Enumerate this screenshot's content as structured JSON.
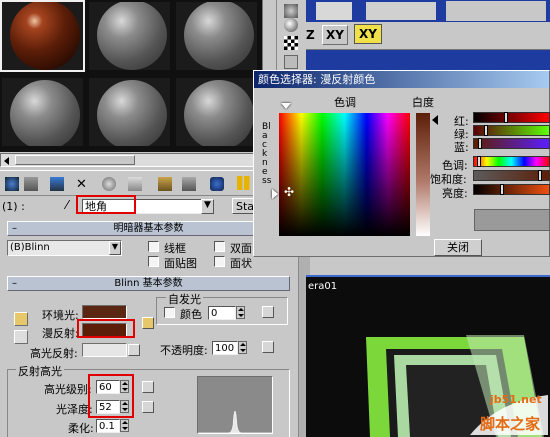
{
  "material_editor": {
    "shader_channel": "(1) :",
    "material_name": "地角",
    "standard_button": "Standard",
    "shader_rollout_title": "明暗器基本参数",
    "shader_type": "(B)Blinn",
    "options": {
      "wire": "线框",
      "two_sided": "双面",
      "face_map": "面贴图",
      "faceted": "面状"
    },
    "blinn_rollout_title": "Blinn 基本参数",
    "ambient_label": "环境光:",
    "diffuse_label": "漫反射:",
    "specular_label": "高光反射:",
    "self_illum_title": "自发光",
    "self_illum_color_label": "颜色",
    "self_illum_value": "0",
    "opacity_label": "不透明度:",
    "opacity_value": "100",
    "specular_group_title": "反射高光",
    "specular_level_label": "高光级别:",
    "specular_level_value": "60",
    "glossiness_label": "光泽度:",
    "glossiness_value": "52",
    "soften_label": "柔化:",
    "soften_value": "0.1",
    "colors": {
      "ambient": "#5a2812",
      "diffuse": "#5c1e08",
      "specular": "#e6e6e6"
    }
  },
  "color_picker": {
    "title": "颜色选择器: 漫反射颜色",
    "hue_header": "色调",
    "whiteness_header": "白度",
    "blackness_vertical": "Blackness",
    "red_label": "红:",
    "green_label": "绿:",
    "blue_label": "蓝:",
    "hue_label": "色调:",
    "saturation_label": "饱和度:",
    "value_label": "亮度:",
    "close_button": "关闭"
  },
  "viewport": {
    "camera_label": "era01",
    "coord_buttons": [
      "Z",
      "XY",
      "XY"
    ]
  },
  "watermark": {
    "site": "jb51.net",
    "name": "脚本之家"
  }
}
